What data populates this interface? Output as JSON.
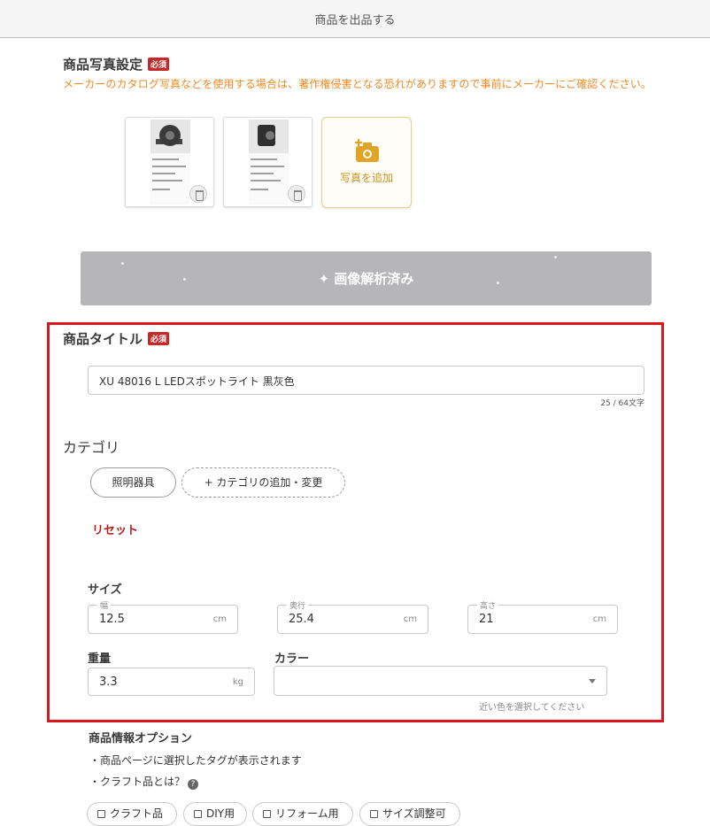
{
  "header": {
    "title": "商品を出品する"
  },
  "photo_section": {
    "title": "商品写真設定",
    "required_badge": "必須",
    "notice": "メーカーのカタログ写真などを使用する場合は、著作権侵害となる恐れがありますので事前にメーカーにご確認ください。",
    "add_photo_label": "写真を追加"
  },
  "analyze_button": {
    "label": "画像解析済み"
  },
  "title_section": {
    "title": "商品タイトル",
    "required_badge": "必須",
    "value": "XU 48016 L LEDスポットライト 黒灰色",
    "counter": "25 / 64文字"
  },
  "category_section": {
    "title": "カテゴリ",
    "selected": "照明器具",
    "add_change": "+ カテゴリの追加・変更",
    "reset": "リセット"
  },
  "size_section": {
    "title": "サイズ",
    "width": {
      "label": "幅",
      "value": "12.5",
      "unit": "cm"
    },
    "depth": {
      "label": "奥行",
      "value": "25.4",
      "unit": "cm"
    },
    "height": {
      "label": "高さ",
      "value": "21",
      "unit": "cm"
    }
  },
  "weight": {
    "title": "重量",
    "value": "3.3",
    "unit": "kg"
  },
  "color": {
    "title": "カラー",
    "value": "",
    "hint": "近い色を選択してください"
  },
  "options": {
    "title": "商品情報オプション",
    "line1": "・商品ページに選択したタグが表示されます",
    "line2": "・クラフト品とは？",
    "help_icon": "?",
    "tags": [
      "クラフト品",
      "DIY用",
      "リフォーム用",
      "サイズ調整可"
    ]
  },
  "colors": {
    "accent_orange": "#f08a24",
    "required_red": "#c62828",
    "highlight_red": "#e0141c",
    "reset_red": "#b71c1c"
  }
}
